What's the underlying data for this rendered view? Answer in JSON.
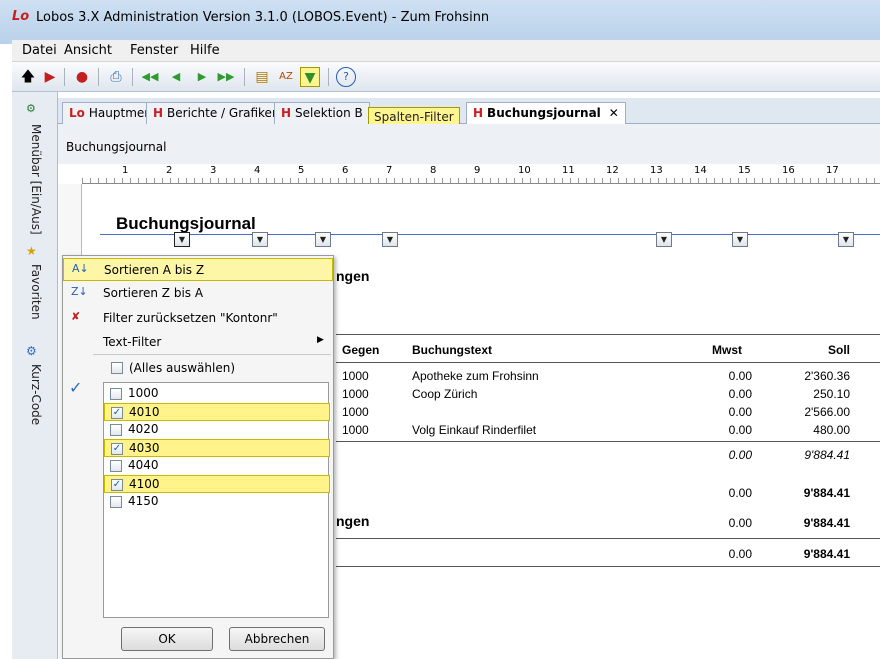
{
  "window": {
    "logo": "Lo",
    "title": "Lobos 3.X Administration Version 3.1.0 (LOBOS.Event) - Zum Frohsinn"
  },
  "menu": [
    "Datei",
    "Ansicht",
    "Fenster",
    "Hilfe"
  ],
  "sidebar": {
    "tabs": [
      "Menübar [Ein/Aus]",
      "Favoriten",
      "Kurz-Code"
    ]
  },
  "tabs": [
    {
      "label": "Hauptmenü"
    },
    {
      "label": "Berichte / Grafiken"
    },
    {
      "label": "Selektion B"
    },
    {
      "label": "Buchungsjournal"
    }
  ],
  "tooltip": "Spalten-Filter",
  "panel": {
    "title": "Buchungsjournal"
  },
  "ruler": [
    "1",
    "2",
    "3",
    "4",
    "5",
    "6",
    "7",
    "8",
    "9",
    "10",
    "11",
    "12",
    "13",
    "14",
    "15",
    "16",
    "17"
  ],
  "report": {
    "title": "Buchungsjournal",
    "section_fragment_1": "ngen",
    "section_fragment_2": "ngen",
    "columns": {
      "gegen": "Gegen",
      "text": "Buchungstext",
      "mwst": "Mwst",
      "soll": "Soll"
    },
    "rows": [
      {
        "gegen": "1000",
        "text": "Apotheke zum Frohsinn",
        "mwst": "0.00",
        "soll": "2'360.36"
      },
      {
        "gegen": "1000",
        "text": "Coop Zürich",
        "mwst": "0.00",
        "soll": "250.10"
      },
      {
        "gegen": "1000",
        "text": "",
        "mwst": "0.00",
        "soll": "2'566.00"
      },
      {
        "gegen": "1000",
        "text": "Volg Einkauf Rinderfilet",
        "mwst": "0.00",
        "soll": "480.00"
      }
    ],
    "subtotal": {
      "mwst": "0.00",
      "soll": "9'884.41"
    },
    "total1": {
      "mwst": "0.00",
      "soll": "9'884.41"
    },
    "total2": {
      "mwst": "0.00",
      "soll": "9'884.41"
    },
    "total3": {
      "mwst": "0.00",
      "soll": "9'884.41"
    }
  },
  "dropdown": {
    "sort_az": "Sortieren A bis Z",
    "sort_za": "Sortieren Z bis A",
    "reset": "Filter zurücksetzen \"Kontonr\"",
    "text_filter": "Text-Filter",
    "select_all": "(Alles auswählen)",
    "items": [
      {
        "label": "1000",
        "checked": false
      },
      {
        "label": "4010",
        "checked": true
      },
      {
        "label": "4020",
        "checked": false
      },
      {
        "label": "4030",
        "checked": true
      },
      {
        "label": "4040",
        "checked": false
      },
      {
        "label": "4100",
        "checked": true
      },
      {
        "label": "4150",
        "checked": false
      }
    ],
    "ok": "OK",
    "cancel": "Abbrechen"
  }
}
